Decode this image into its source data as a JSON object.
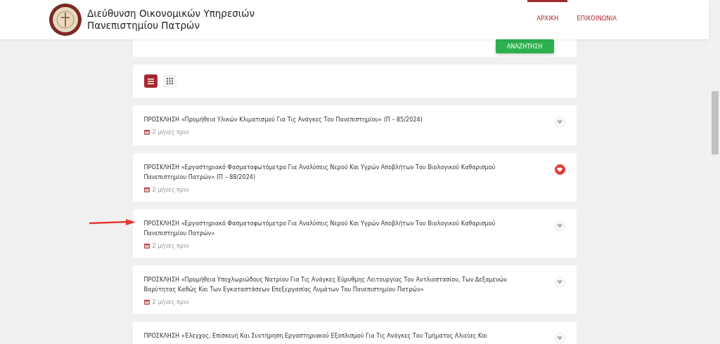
{
  "header": {
    "title_line_1": "Διεύθυνση Οικονομικών Υπηρεσιών",
    "title_line_2": "Πανεπιστημίου Πατρών",
    "nav": [
      {
        "label": "ΑΡΧΙΚΗ",
        "selected": true
      },
      {
        "label": "ΕΠΙΚΟΙΝΩΝΙΑ",
        "selected": false
      }
    ]
  },
  "search": {
    "button": "ΑΝΑΖΗΤΗΣΗ"
  },
  "view_toggle": [
    {
      "kind": "list",
      "selected": true
    },
    {
      "kind": "grid",
      "selected": false
    }
  ],
  "items": [
    {
      "title": "ΠΡΟΣΚΛΗΣΗ «Προμήθεια Υλικών Κλιματισμού Για Τις Ανάγκες Του Πανεπιστημίου» (Π – 85/2024)",
      "date": "2 μήνες πριν",
      "favorite": false,
      "highlighted": false
    },
    {
      "title": "ΠΡΟΣΚΛΗΣΗ «Εργαστηριακό Φασματοφωτόμετρο Για Αναλύσεις Νερού Και Υγρών Αποβλήτων Του Βιολογικού Καθαρισμού Πανεπιστημίου Πατρών» (Π – 88/2024)",
      "date": "2 μήνες πριν",
      "favorite": true,
      "highlighted": false
    },
    {
      "title": "ΠΡΟΣΚΛΗΣΗ «Εργαστηριακό Φασματοφωτόμετρο Για Αναλύσεις Νερού Και Υγρών Αποβλήτων Του Βιολογικού Καθαρισμού Πανεπιστημίου Πατρών»",
      "date": "2 μήνες πριν",
      "favorite": false,
      "highlighted": true
    },
    {
      "title": "ΠΡΟΣΚΛΗΣΗ «Προμήθεια Υποχλωριώδους Νατρίου Για Τις Ανάγκες Εύρυθμης Λειτουργίας Του Αντλιοστασίου, Των Δεξαμενών Βαρύτητας Καθώς Και Των Εγκαταστάσεων Επεξεργασίας Λυμάτων Του Πανεπιστημίου Πατρών»",
      "date": "2 μήνες πριν",
      "favorite": false,
      "highlighted": false
    },
    {
      "title": "ΠΡΟΣΚΛΗΣΗ «Έλεγχος, Επισκευή Και Συντήρηση Εργαστηριακού Εξοπλισμού Για Τις Ανάγκες Του Τμήματος Αλιείας Και",
      "favorite": false,
      "highlighted": false
    }
  ]
}
